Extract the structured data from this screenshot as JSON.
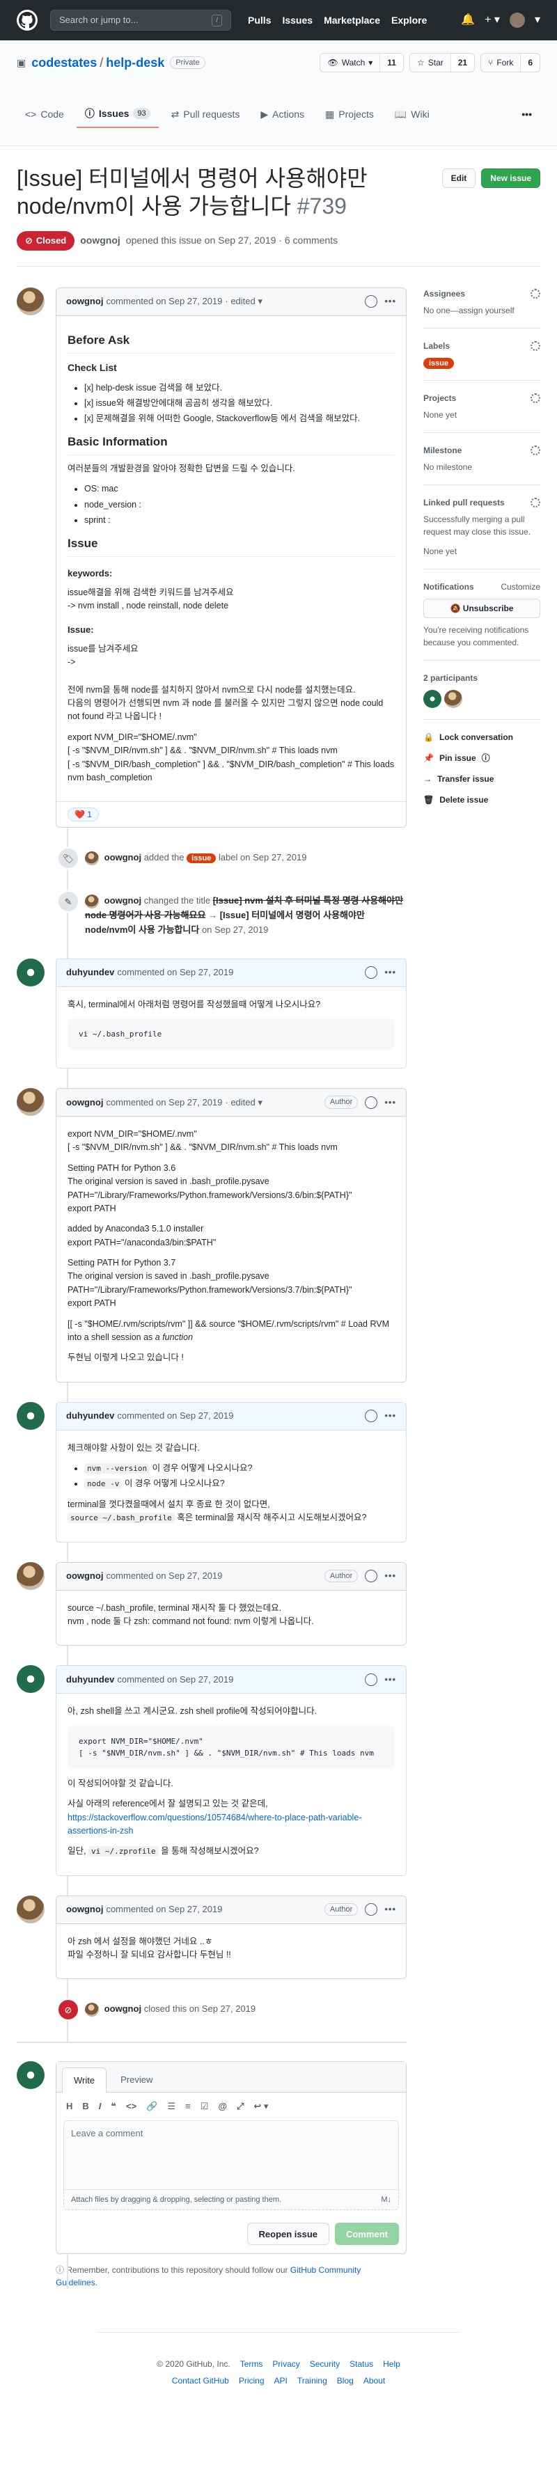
{
  "header": {
    "search_placeholder": "Search or jump to...",
    "search_key": "/",
    "nav": [
      "Pulls",
      "Issues",
      "Marketplace",
      "Explore"
    ]
  },
  "repo": {
    "owner": "codestates",
    "name": "help-desk",
    "visibility": "Private",
    "watch_label": "Watch",
    "watch_count": "11",
    "star_label": "Star",
    "star_count": "21",
    "fork_label": "Fork",
    "fork_count": "6",
    "tabs": {
      "code": "Code",
      "issues": "Issues",
      "issues_count": "93",
      "pulls": "Pull requests",
      "actions": "Actions",
      "projects": "Projects",
      "wiki": "Wiki",
      "more": "•••"
    }
  },
  "issue": {
    "title": "[Issue] 터미널에서 명령어 사용해야만 node/nvm이 사용 가능합니다",
    "number": "#739",
    "state": "Closed",
    "edit_label": "Edit",
    "new_issue_label": "New issue",
    "author": "oowgnoj",
    "opened_text": "opened this issue on Sep 27, 2019 · 6 comments"
  },
  "comments": {
    "c1": {
      "author": "oowgnoj",
      "meta": "commented on Sep 27, 2019",
      "edited": "· edited ▾",
      "h_before": "Before Ask",
      "h_checklist": "Check List",
      "check1": "[x] help-desk issue 검색을 해 보았다.",
      "check2": "[x] issue와 해결방안에대해 곰곰히 생각을 해보았다.",
      "check3": "[x] 문제해결을 위해 어떠한 Google, Stackoverflow등 에서 검색을 해보았다.",
      "h_basic": "Basic Information",
      "basic_intro": "여러분들의 개발환경을 알아야 정확한 답변을 드릴 수 있습니다.",
      "os": "OS: mac",
      "node": "node_version :",
      "sprint": "sprint :",
      "h_issue": "Issue",
      "h_keywords": "keywords:",
      "kw1": "issue해결을 위해 검색한 키워드를 남겨주세요",
      "kw2": "-> nvm install , node reinstall, node delete",
      "h_issue2": "Issue:",
      "iss1": "issue를 남겨주세요",
      "iss2": "->",
      "desc1": "전에 nvm을 통해 node를 설치하지 않아서 nvm으로 다시 node를 설치했는데요.",
      "desc2": "다음의 명령어가 선행되면 nvm 과 node 를 불러올 수 있지만 그렇지 않으면 node could not found 라고 나옵니다 !",
      "exp1": "export NVM_DIR=\"$HOME/.nvm\"",
      "exp2": "[ -s \"$NVM_DIR/nvm.sh\" ] && . \"$NVM_DIR/nvm.sh\" # This loads nvm",
      "exp3": "[ -s \"$NVM_DIR/bash_completion\" ] && . \"$NVM_DIR/bash_completion\" # This loads nvm bash_completion",
      "reaction": "❤️ 1"
    },
    "e1": {
      "actor": "oowgnoj",
      "action": "added the",
      "label": "issue",
      "suffix": "label on Sep 27, 2019"
    },
    "e2": {
      "actor": "oowgnoj",
      "action": "changed the title",
      "old": "[Issue] nvm 설치 후 터미널 특정 명령 사용해야만 node 명령어가 사용 가능해요요",
      "arrow": "→",
      "new": "[Issue] 터미널에서 명령어 사용해야만 node/nvm이 사용 가능합니다",
      "suffix": "on Sep 27, 2019"
    },
    "c2": {
      "author": "duhyundev",
      "meta": "commented on Sep 27, 2019",
      "body": "혹시, terminal에서 아래처럼 명령어를 작성했을때 어떻게 나오시나요?",
      "code": "vi ~/.bash_profile"
    },
    "c3": {
      "author": "oowgnoj",
      "meta": "commented on Sep 27, 2019",
      "edited": "· edited ▾",
      "badge": "Author",
      "l1": "export NVM_DIR=\"$HOME/.nvm\"",
      "l2": "[ -s \"$NVM_DIR/nvm.sh\" ] && . \"$NVM_DIR/nvm.sh\" # This loads nvm",
      "l3": "Setting PATH for Python 3.6",
      "l4": "The original version is saved in .bash_profile.pysave",
      "l5": "PATH=\"/Library/Frameworks/Python.framework/Versions/3.6/bin:${PATH}\"",
      "l6": "export PATH",
      "l7": "added by Anaconda3 5.1.0 installer",
      "l8": "export PATH=\"/anaconda3/bin:$PATH\"",
      "l9": "Setting PATH for Python 3.7",
      "l10": "The original version is saved in .bash_profile.pysave",
      "l11": "PATH=\"/Library/Frameworks/Python.framework/Versions/3.7/bin:${PATH}\"",
      "l12": "export PATH",
      "l13": "[[ -s \"$HOME/.rvm/scripts/rvm\" ]] && source \"$HOME/.rvm/scripts/rvm\" # Load RVM into a shell session as",
      "l13i": "a function",
      "l14": "두현님 이렇게 나오고 있습니다 !"
    },
    "c4": {
      "author": "duhyundev",
      "meta": "commented on Sep 27, 2019",
      "p1": "체크해야할 사항이 있는 것 같습니다.",
      "b1_code": "nvm --version",
      "b1_text": "이 경우 어떻게 나오시나요?",
      "b2_code": "node -v",
      "b2_text": "이 경우 어떻게 나오시나요?",
      "p2": "terminal을 껏다켰을때에서 설치 후 종료 한 것이 없다면,",
      "p3_code": "source ~/.bash_profile",
      "p3_text": "혹은 terminal을 재시작 해주시고 시도해보시겠어요?"
    },
    "c5": {
      "author": "oowgnoj",
      "meta": "commented on Sep 27, 2019",
      "badge": "Author",
      "p1": "source ~/.bash_profile, terminal 재시작 둘 다 했었는데요.",
      "p2": "nvm , node 둘 다 zsh: command not found: nvm 이렇게 나옵니다."
    },
    "c6": {
      "author": "duhyundev",
      "meta": "commented on Sep 27, 2019",
      "p1": "아, zsh shell을 쓰고 계시군요. zsh shell profile에 작성되어야합니다.",
      "code": "export NVM_DIR=\"$HOME/.nvm\"\n[ -s \"$NVM_DIR/nvm.sh\" ] && . \"$NVM_DIR/nvm.sh\" # This loads nvm",
      "p2": "이 작성되어야할 것 같습니다.",
      "p3": "사실 아래의 reference에서 잘 설명되고 있는 것 같은데,",
      "link": "https://stackoverflow.com/questions/10574684/where-to-place-path-variable-assertions-in-zsh",
      "p4_pre": "일단,",
      "p4_code": "vi ~/.zprofile",
      "p4_post": "을 통해 작성해보시겠어요?"
    },
    "c7": {
      "author": "oowgnoj",
      "meta": "commented on Sep 27, 2019",
      "badge": "Author",
      "p1": "아 zsh 에서 설정을 해야했던 거네요 ..ㅎ",
      "p2": "파일 수정하니 잘 되네요 감사합니다 두현님 !!"
    },
    "e3": {
      "actor": "oowgnoj",
      "suffix": "closed this on Sep 27, 2019"
    }
  },
  "form": {
    "write": "Write",
    "preview": "Preview",
    "placeholder": "Leave a comment",
    "attach": "Attach files by dragging & dropping, selecting or pasting them.",
    "reopen": "Reopen issue",
    "submit": "Comment",
    "remember_pre": "Remember, contributions to this repository should follow our",
    "remember_link": "GitHub Community Guidelines",
    "remember_post": "."
  },
  "sidebar": {
    "assignees_h": "Assignees",
    "assignees_v": "No one—assign yourself",
    "labels_h": "Labels",
    "labels_v": "issue",
    "projects_h": "Projects",
    "projects_v": "None yet",
    "milestone_h": "Milestone",
    "milestone_v": "No milestone",
    "linked_h": "Linked pull requests",
    "linked_v": "Successfully merging a pull request may close this issue.",
    "linked_v2": "None yet",
    "notif_h": "Notifications",
    "notif_customize": "Customize",
    "unsubscribe": "Unsubscribe",
    "notif_v": "You're receiving notifications because you commented.",
    "participants": "2 participants",
    "lock": "Lock conversation",
    "pin": "Pin issue",
    "transfer": "Transfer issue",
    "delete": "Delete issue"
  },
  "footer": {
    "copy": "© 2020 GitHub, Inc.",
    "row1": [
      "Terms",
      "Privacy",
      "Security",
      "Status",
      "Help"
    ],
    "row2": [
      "Contact GitHub",
      "Pricing",
      "API",
      "Training",
      "Blog",
      "About"
    ]
  },
  "colors": {
    "closed": "#cb2431",
    "label": "#d93f0b",
    "green": "#2ea44f",
    "link": "#0366d6"
  }
}
